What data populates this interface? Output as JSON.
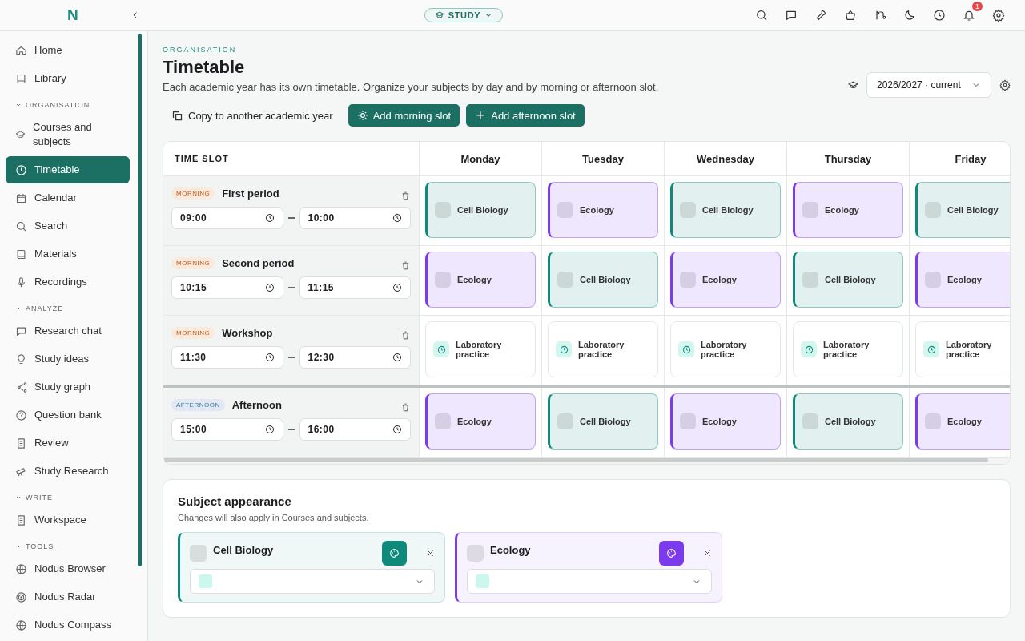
{
  "brand": {
    "logo": "N"
  },
  "mode_switch": {
    "label": "STUDY"
  },
  "notifications": {
    "count": "1"
  },
  "sidebar": {
    "sections": [
      {
        "items": [
          {
            "label": "Home",
            "selected": false
          },
          {
            "label": "Library",
            "selected": false
          }
        ]
      },
      {
        "label": "ORGANISATION",
        "items": [
          {
            "label": "Courses and subjects",
            "selected": false
          },
          {
            "label": "Timetable",
            "selected": true
          },
          {
            "label": "Calendar",
            "selected": false
          },
          {
            "label": "Search",
            "selected": false
          },
          {
            "label": "Materials",
            "selected": false
          },
          {
            "label": "Recordings",
            "selected": false
          }
        ]
      },
      {
        "label": "ANALYZE",
        "items": [
          {
            "label": "Research chat",
            "selected": false
          },
          {
            "label": "Study ideas",
            "selected": false
          },
          {
            "label": "Study graph",
            "selected": false
          },
          {
            "label": "Question bank",
            "selected": false
          },
          {
            "label": "Review",
            "selected": false
          },
          {
            "label": "Study Research",
            "selected": false
          }
        ]
      },
      {
        "label": "WRITE",
        "items": [
          {
            "label": "Workspace",
            "selected": false
          }
        ]
      },
      {
        "label": "TOOLS",
        "items": [
          {
            "label": "Nodus Browser",
            "selected": false
          },
          {
            "label": "Nodus Radar",
            "selected": false
          },
          {
            "label": "Nodus Compass",
            "selected": false
          }
        ]
      }
    ]
  },
  "page": {
    "eyebrow": "ORGANISATION",
    "title": "Timetable",
    "description": "Each academic year has its own timetable. Organize your subjects by day and by morning or afternoon slot.",
    "year": "2026/2027 · current"
  },
  "actions": [
    {
      "label": "Copy to another academic year",
      "kind": "copy"
    },
    {
      "label": "Add morning slot",
      "kind": "morning"
    },
    {
      "label": "Add afternoon slot",
      "kind": "afternoon"
    }
  ],
  "table": {
    "slot_header": "TIME SLOT",
    "days": [
      "Monday",
      "Tuesday",
      "Wednesday",
      "Thursday",
      "Friday"
    ],
    "rows": [
      {
        "badge": "MORNING",
        "kind": "morning",
        "name": "First period",
        "start": "09:00",
        "end": "10:00",
        "cells": [
          {
            "kind": "subject",
            "label": "Cell Biology",
            "color": "#0f8a7a"
          },
          {
            "kind": "subject",
            "label": "Ecology",
            "color": "#7c3aed"
          },
          {
            "kind": "subject",
            "label": "Cell Biology",
            "color": "#0f8a7a"
          },
          {
            "kind": "subject",
            "label": "Ecology",
            "color": "#7c3aed"
          },
          {
            "kind": "subject",
            "label": "Cell Biology",
            "color": "#0f8a7a"
          }
        ]
      },
      {
        "badge": "MORNING",
        "kind": "morning",
        "name": "Second period",
        "start": "10:15",
        "end": "11:15",
        "cells": [
          {
            "kind": "subject",
            "label": "Ecology",
            "color": "#7c3aed"
          },
          {
            "kind": "subject",
            "label": "Cell Biology",
            "color": "#0f8a7a"
          },
          {
            "kind": "subject",
            "label": "Ecology",
            "color": "#7c3aed"
          },
          {
            "kind": "subject",
            "label": "Cell Biology",
            "color": "#0f8a7a"
          },
          {
            "kind": "subject",
            "label": "Ecology",
            "color": "#7c3aed"
          }
        ]
      },
      {
        "badge": "MORNING",
        "kind": "morning",
        "name": "Workshop",
        "start": "11:30",
        "end": "12:30",
        "cells": [
          {
            "kind": "activity",
            "label": "Laboratory practice"
          },
          {
            "kind": "activity",
            "label": "Laboratory practice"
          },
          {
            "kind": "activity",
            "label": "Laboratory practice"
          },
          {
            "kind": "activity",
            "label": "Laboratory practice"
          },
          {
            "kind": "activity",
            "label": "Laboratory practice"
          }
        ]
      },
      {
        "badge": "AFTERNOON",
        "kind": "afternoon",
        "name": "Afternoon",
        "start": "15:00",
        "end": "16:00",
        "cells": [
          {
            "kind": "subject",
            "label": "Ecology",
            "color": "#7c3aed"
          },
          {
            "kind": "subject",
            "label": "Cell Biology",
            "color": "#0f8a7a"
          },
          {
            "kind": "subject",
            "label": "Ecology",
            "color": "#7c3aed"
          },
          {
            "kind": "subject",
            "label": "Cell Biology",
            "color": "#0f8a7a"
          },
          {
            "kind": "subject",
            "label": "Ecology",
            "color": "#7c3aed"
          }
        ]
      }
    ]
  },
  "appearance": {
    "title": "Subject appearance",
    "note": "Changes will also apply in Courses and subjects.",
    "subjects": [
      {
        "name": "Cell Biology",
        "color": "#0f8a7a"
      },
      {
        "name": "Ecology",
        "color": "#7c3aed"
      }
    ]
  }
}
